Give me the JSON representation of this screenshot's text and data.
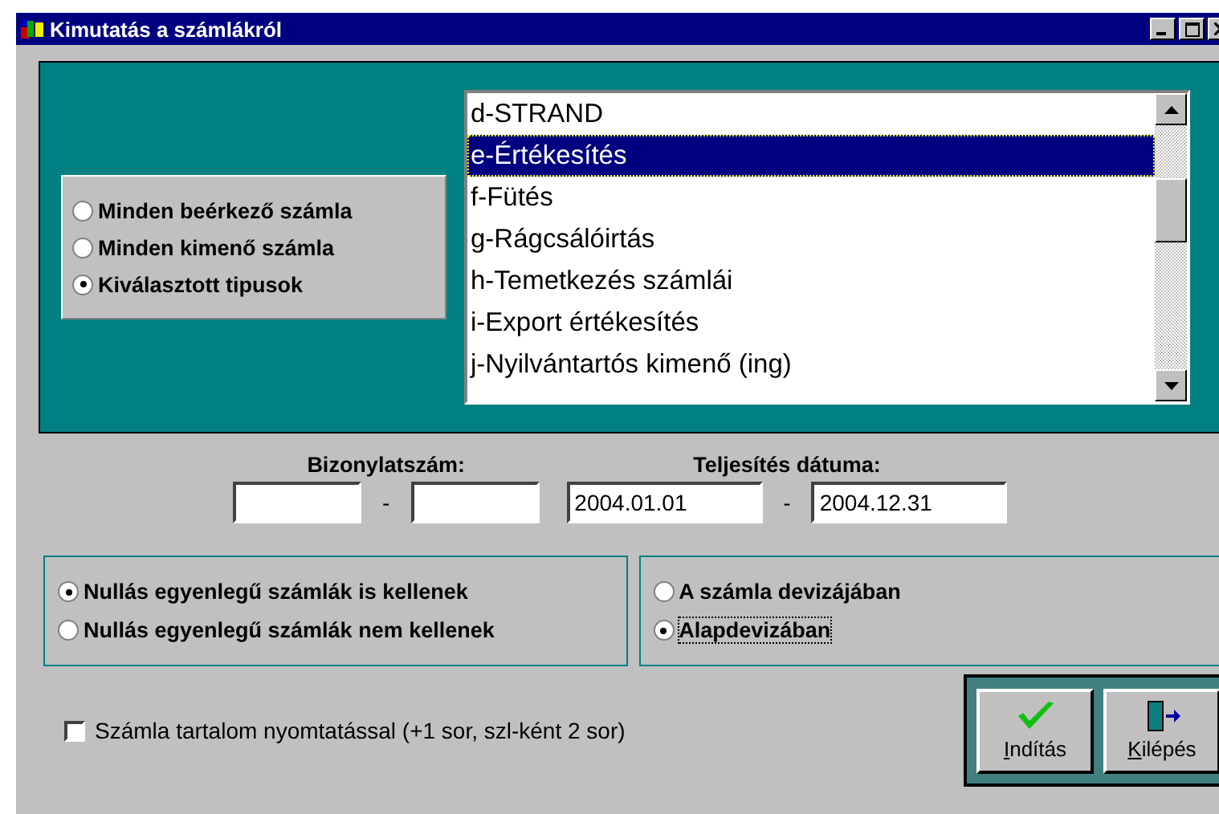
{
  "window": {
    "title": "Kimutatás a számlákról"
  },
  "source_options": [
    {
      "label": "Minden beérkező számla",
      "selected": false
    },
    {
      "label": "Minden kimenő számla",
      "selected": false
    },
    {
      "label": "Kiválasztott tipusok",
      "selected": true
    }
  ],
  "type_list": {
    "items": [
      {
        "label": "d-STRAND",
        "selected": false
      },
      {
        "label": "e-Értékesítés",
        "selected": true
      },
      {
        "label": "f-Fütés",
        "selected": false
      },
      {
        "label": "g-Rágcsálóirtás",
        "selected": false
      },
      {
        "label": "h-Temetkezés számlái",
        "selected": false
      },
      {
        "label": "i-Export értékesítés",
        "selected": false
      },
      {
        "label": "j-Nyilvántartós kimenő (ing)",
        "selected": false
      }
    ]
  },
  "document_number": {
    "label": "Bizonylatszám:",
    "separator": "-"
  },
  "completion_date": {
    "label": "Teljesítés dátuma:",
    "from": "2004.01.01",
    "to": "2004.12.31",
    "separator": "-"
  },
  "zero_balance_options": [
    {
      "label": "Nullás egyenlegű számlák is kellenek",
      "selected": true
    },
    {
      "label": "Nullás egyenlegű számlák nem kellenek",
      "selected": false
    }
  ],
  "currency_options": [
    {
      "label": "A számla devizájában",
      "selected": false
    },
    {
      "label": "Alapdevizában",
      "selected": true
    }
  ],
  "print_content": {
    "label": "Számla tartalom nyomtatással (+1 sor, szl-ként 2 sor)",
    "checked": false
  },
  "buttons": [
    {
      "kind": "start",
      "label": "Indítás"
    },
    {
      "kind": "exit",
      "label": "Kilépés"
    }
  ]
}
